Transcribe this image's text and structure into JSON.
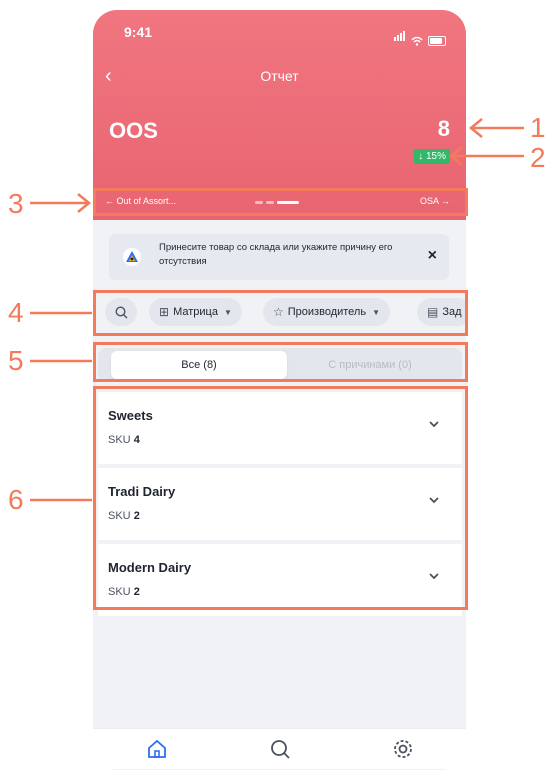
{
  "status_bar": {
    "time": "9:41"
  },
  "nav": {
    "back": "‹",
    "title": "Отчет"
  },
  "metric": {
    "name": "OOS",
    "value": "8",
    "delta": "↓ 15%"
  },
  "pager": {
    "prev": "← Out of Assort...",
    "next": "OSA →"
  },
  "banner": {
    "text": "Принесите товар со склада или укажите причину его отсутствия",
    "close": "×"
  },
  "filters": {
    "matrix": "Матрица",
    "manufacturer": "Производитель",
    "tasks": "Зад"
  },
  "segments": {
    "all": "Все (8)",
    "with_reasons": "С причинами (0)"
  },
  "categories": [
    {
      "name": "Sweets",
      "sku_label": "SKU",
      "sku_count": "4"
    },
    {
      "name": "Tradi Dairy",
      "sku_label": "SKU",
      "sku_count": "2"
    },
    {
      "name": "Modern Dairy",
      "sku_label": "SKU",
      "sku_count": "2"
    }
  ],
  "callouts": [
    "1",
    "2",
    "3",
    "4",
    "5",
    "6"
  ],
  "colors": {
    "header": "#ec6b77",
    "delta_badge": "#33b86a",
    "callout": "#f47a5c"
  }
}
